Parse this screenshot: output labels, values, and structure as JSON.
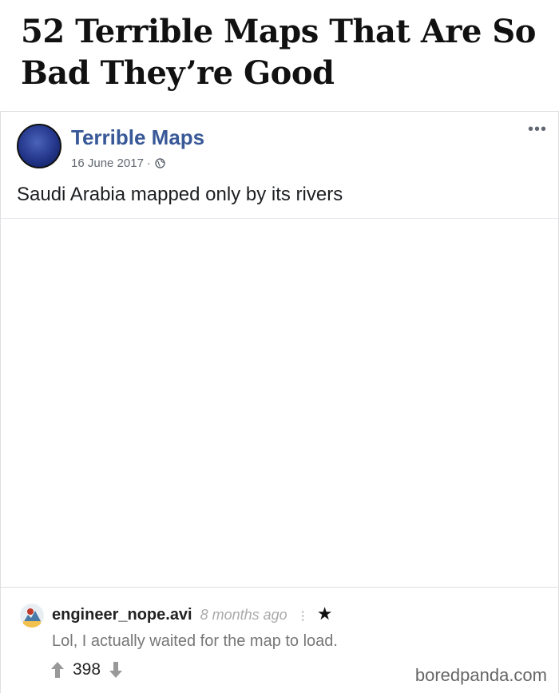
{
  "article": {
    "title": "52 Terrible Maps That Are So Bad They’re Good"
  },
  "post": {
    "page_name": "Terrible Maps",
    "date": "16 June 2017",
    "separator": "·",
    "more_icon": "more-options-icon",
    "privacy_icon": "globe-icon",
    "text": "Saudi Arabia mapped only by its rivers"
  },
  "comment": {
    "username": "engineer_nope.avi",
    "time": "8 months ago",
    "text": "Lol, I actually waited for the map to load.",
    "votes": "398",
    "kebab": "⋮",
    "star": "★"
  },
  "watermark": "boredpanda.com",
  "colors": {
    "page_link": "#385898",
    "meta_gray": "#606770",
    "comment_gray": "#777777"
  }
}
